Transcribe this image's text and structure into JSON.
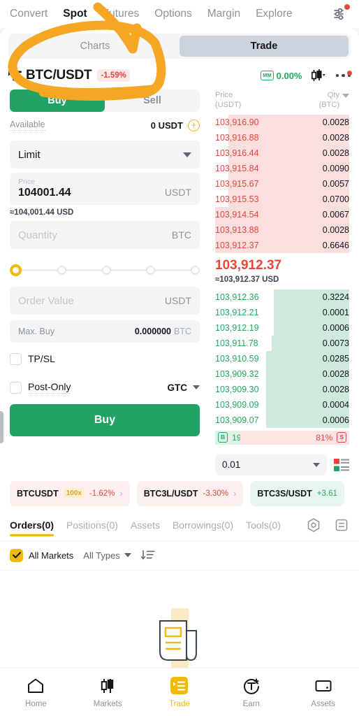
{
  "topnav": {
    "items": [
      {
        "label": "Convert",
        "active": false
      },
      {
        "label": "Spot",
        "active": true
      },
      {
        "label": "Futures",
        "active": false
      },
      {
        "label": "Options",
        "active": false
      },
      {
        "label": "Margin",
        "active": false
      },
      {
        "label": "Explore",
        "active": false
      }
    ],
    "settings_icon": "sliders-icon"
  },
  "segment": {
    "charts_label": "Charts",
    "trade_label": "Trade",
    "active": "Trade"
  },
  "pair": {
    "menu_icon": "list-menu-icon",
    "name": "BTC/USDT",
    "change": "-1.59%",
    "mm_badge": "MM",
    "mm_value": "0.00%",
    "candle_icon": "candlestick-icon",
    "more_icon": "more-dots-icon"
  },
  "order_form": {
    "buy_label": "Buy",
    "sell_label": "Sell",
    "side_active": "Buy",
    "available_label": "Available",
    "available_value": "0 USDT",
    "add_funds_icon": "plus-circle-icon",
    "order_type": "Limit",
    "price_label": "Price",
    "price_value": "104001.44",
    "price_unit": "USDT",
    "price_approx": "≈104,001.44 USD",
    "quantity_placeholder": "Quantity",
    "quantity_unit": "BTC",
    "slider_percent": 0,
    "order_value_placeholder": "Order Value",
    "order_value_unit": "USDT",
    "max_buy_label": "Max. Buy",
    "max_buy_value": "0.000000",
    "max_buy_unit": "BTC",
    "tpsl_label": "TP/SL",
    "tpsl_checked": false,
    "post_only_label": "Post-Only",
    "post_only_checked": false,
    "tif": "GTC",
    "submit_label": "Buy"
  },
  "orderbook": {
    "col_price_line1": "Price",
    "col_price_line2": "(USDT)",
    "col_qty_line1": "Qty",
    "col_qty_line2": "(BTC)",
    "asks": [
      {
        "price": "103,916.90",
        "qty": "0.0028",
        "depth": 90
      },
      {
        "price": "103,916.88",
        "qty": "0.0028",
        "depth": 90
      },
      {
        "price": "103,916.44",
        "qty": "0.0028",
        "depth": 90
      },
      {
        "price": "103,915.84",
        "qty": "0.0090",
        "depth": 90
      },
      {
        "price": "103,915.67",
        "qty": "0.0057",
        "depth": 90
      },
      {
        "price": "103,915.53",
        "qty": "0.0700",
        "depth": 90
      },
      {
        "price": "103,914.54",
        "qty": "0.0067",
        "depth": 100
      },
      {
        "price": "103,913.88",
        "qty": "0.0028",
        "depth": 100
      },
      {
        "price": "103,912.37",
        "qty": "0.6646",
        "depth": 100
      }
    ],
    "mid_price": "103,912.37",
    "mid_approx": "≈103,912.37 USD",
    "bids": [
      {
        "price": "103,912.36",
        "qty": "0.3224",
        "depth": 56
      },
      {
        "price": "103,912.21",
        "qty": "0.0001",
        "depth": 56
      },
      {
        "price": "103,912.19",
        "qty": "0.0006",
        "depth": 56
      },
      {
        "price": "103,911.78",
        "qty": "0.0073",
        "depth": 58
      },
      {
        "price": "103,910.59",
        "qty": "0.0285",
        "depth": 62
      },
      {
        "price": "103,909.32",
        "qty": "0.0028",
        "depth": 62
      },
      {
        "price": "103,909.30",
        "qty": "0.0028",
        "depth": 62
      },
      {
        "price": "103,909.09",
        "qty": "0.0004",
        "depth": 62
      },
      {
        "price": "103,909.07",
        "qty": "0.0006",
        "depth": 62
      }
    ],
    "buy_tag": "B",
    "buy_ratio": "19%",
    "sell_ratio": "81%",
    "sell_tag": "S",
    "buy_ratio_pct": 19,
    "sell_ratio_pct": 81,
    "depth_step": "0.01",
    "view_mode_icon": "orderbook-layout-icon"
  },
  "tickers": [
    {
      "name": "BTCUSDT",
      "leverage": "100x",
      "change": "-1.62%",
      "tone": "red"
    },
    {
      "name": "BTC3L/USDT",
      "leverage": "",
      "change": "-3.30%",
      "tone": "red"
    },
    {
      "name": "BTC3S/USDT",
      "leverage": "",
      "change": "+3.61",
      "tone": "green"
    }
  ],
  "order_tabs": {
    "items": [
      {
        "label": "Orders(0)",
        "active": true
      },
      {
        "label": "Positions(0)",
        "active": false
      },
      {
        "label": "Assets",
        "active": false
      },
      {
        "label": "Borrowings(0)",
        "active": false
      },
      {
        "label": "Tools(0)",
        "active": false
      }
    ],
    "settings_icon": "hexagon-gear-icon",
    "list_icon": "document-list-icon"
  },
  "filters": {
    "all_markets_label": "All Markets",
    "all_markets_checked": true,
    "all_types_label": "All Types",
    "sort_icon": "sort-descending-icon"
  },
  "empty_state": {
    "icon": "empty-document-icon"
  },
  "bottomnav": {
    "items": [
      {
        "label": "Home",
        "icon": "home-icon",
        "active": false
      },
      {
        "label": "Markets",
        "icon": "candlestick-icon",
        "active": false
      },
      {
        "label": "Trade",
        "icon": "trade-list-icon",
        "active": true
      },
      {
        "label": "Earn",
        "icon": "earn-coin-icon",
        "active": false
      },
      {
        "label": "Assets",
        "icon": "wallet-icon",
        "active": false
      }
    ]
  },
  "colors": {
    "buy_green": "#21a366",
    "sell_red": "#e8453c",
    "accent_yellow": "#f0b90b",
    "annotation_orange": "#f5a623",
    "trade_tab_bg": "#ccd3dc"
  }
}
